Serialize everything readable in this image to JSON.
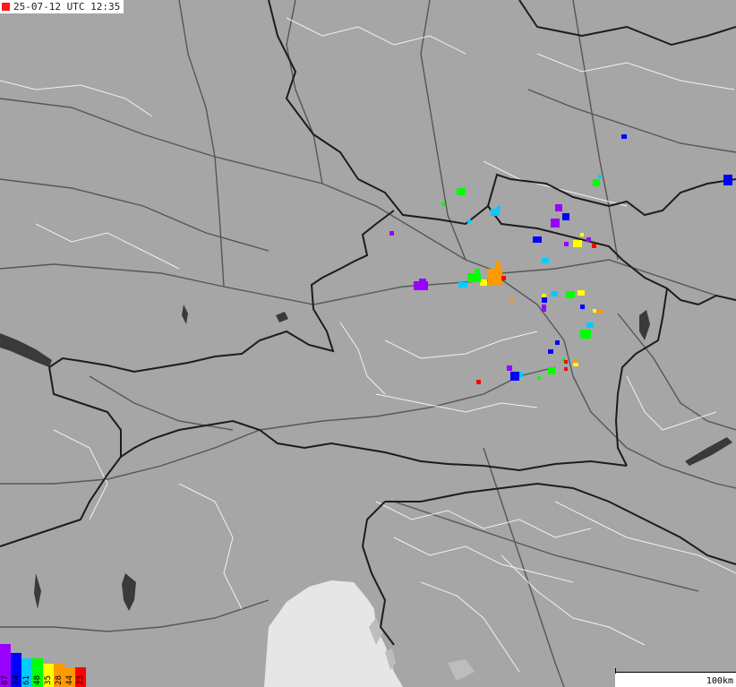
{
  "header": {
    "timestamp": "25-07-12 UTC 12:35"
  },
  "colors": {
    "timestamp_marker": "#ff1a1a",
    "land": "#a6a6a6",
    "dark_land": "#7f7f7f",
    "sea": "#e6e6e6",
    "lake": "#3a3a3a",
    "roads": "#565656",
    "borders": "#1c1c1c",
    "regional_borders": "#ffffff"
  },
  "legend": {
    "bars": [
      {
        "label": "87",
        "color": "#9900ff"
      },
      {
        "label": "74",
        "color": "#0000ff"
      },
      {
        "label": "61",
        "color": "#00ccff"
      },
      {
        "label": "48",
        "color": "#00ff00"
      },
      {
        "label": "35",
        "color": "#ffff00"
      },
      {
        "label": "28",
        "color": "#ff9900"
      },
      {
        "label": "44",
        "color": "#ff9900"
      },
      {
        "label": "23",
        "color": "#ff0000"
      }
    ]
  },
  "scale": {
    "label": "100km"
  },
  "map": {
    "icon": "lightning-map",
    "features": [
      "country-borders",
      "regional-borders",
      "roads",
      "lakes",
      "adriatic-sea"
    ]
  }
}
